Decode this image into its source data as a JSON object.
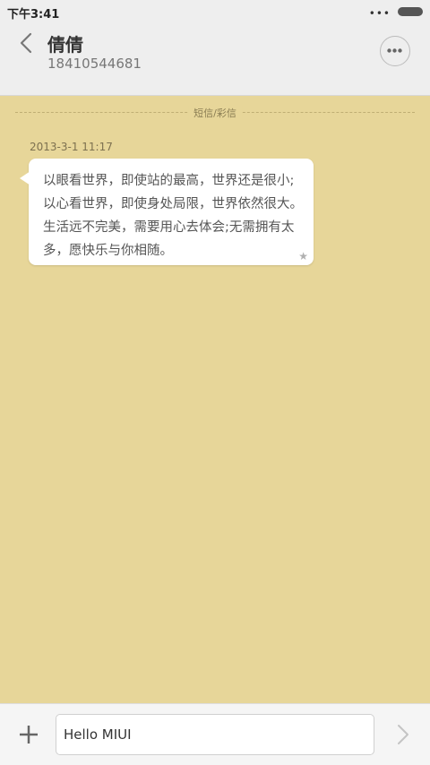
{
  "status_bar": {
    "time": "下午3:41",
    "signal_icon": "more-dots-icon",
    "battery_icon": "battery-icon"
  },
  "header": {
    "title": "倩倩",
    "subtitle": "18410544681",
    "back_icon": "back-arrow-icon",
    "more_icon": "more-options-icon"
  },
  "conversation": {
    "divider_label": "短信/彩信",
    "messages": [
      {
        "timestamp": "2013-3-1 11:17",
        "text": "以眼看世界，即使站的最高，世界还是很小;以心看世界，即使身处局限，世界依然很大。生活远不完美，需要用心去体会;无需拥有太多，愿快乐与你相随。",
        "starred_icon": "star-icon"
      }
    ]
  },
  "composer": {
    "add_icon": "plus-icon",
    "input_value": "Hello MIUI",
    "send_icon": "send-arrow-icon"
  },
  "colors": {
    "background": "#e7d699",
    "header_bg": "#eeeeee",
    "bubble_bg": "#ffffff"
  }
}
